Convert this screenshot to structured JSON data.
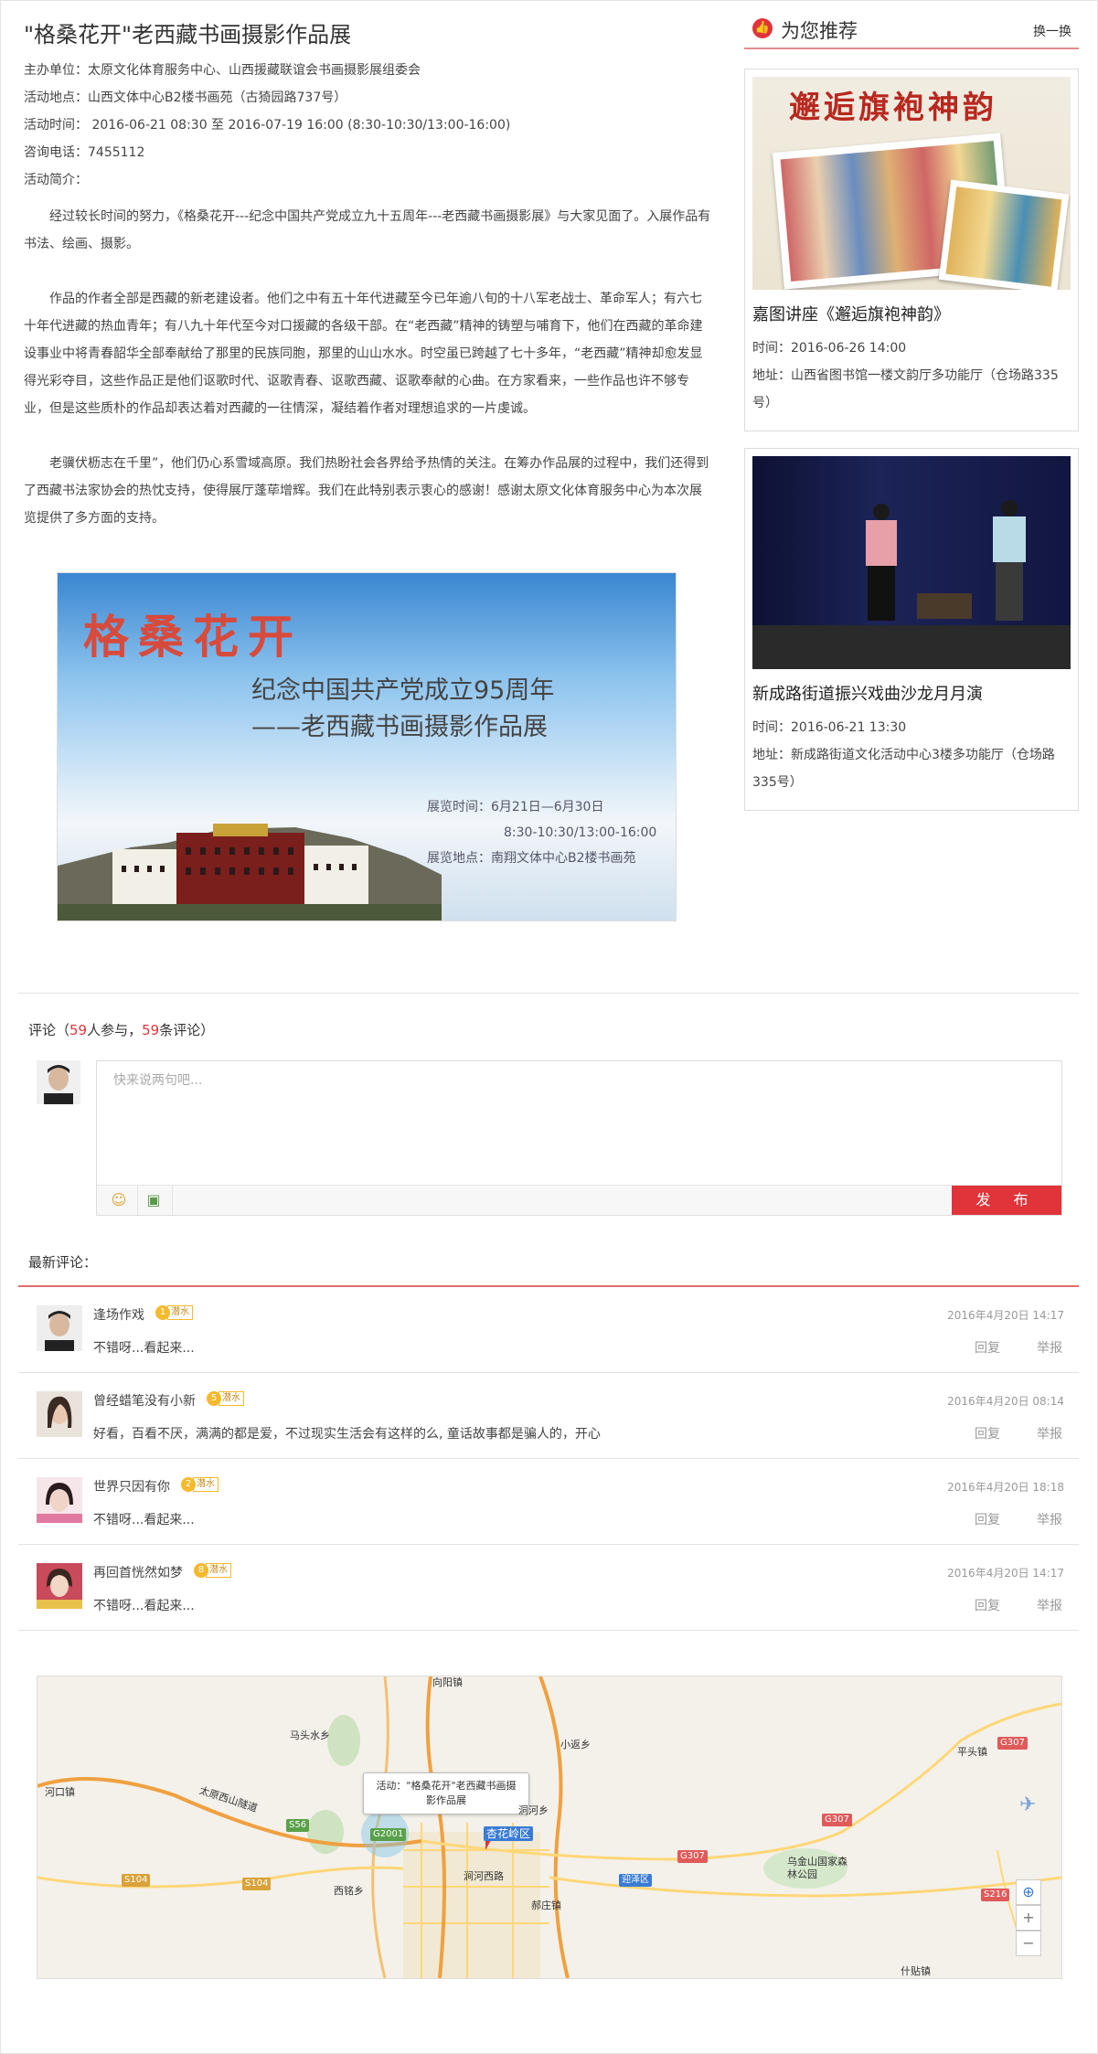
{
  "event": {
    "title": "\"格桑花开\"老西藏书画摄影作品展",
    "meta": [
      "主办单位：太原文化体育服务中心、山西援藏联谊会书画摄影展组委会",
      "活动地点：山西文体中心B2楼书画苑（古猗园路737号）",
      "活动时间： 2016-06-21 08:30 至 2016-07-19 16:00 (8:30-10:30/13:00-16:00)",
      "咨询电话：7455112",
      "活动简介："
    ],
    "intro": [
      "经过较长时间的努力，《格桑花开---纪念中国共产党成立九十五周年---老西藏书画摄影展》与大家见面了。入展作品有书法、绘画、摄影。",
      "作品的作者全部是西藏的新老建设者。他们之中有五十年代进藏至今已年逾八旬的十八军老战士、革命军人；有六七十年代进藏的热血青年；有八九十年代至今对口援藏的各级干部。在“老西藏”精神的铸塑与哺育下，他们在西藏的革命建设事业中将青春韶华全部奉献给了那里的民族同胞，那里的山山水水。时空虽已跨越了七十多年，“老西藏”精神却愈发显得光彩夺目，这些作品正是他们讴歌时代、讴歌青春、讴歌西藏、讴歌奉献的心曲。在方家看来，一些作品也许不够专业，但是这些质朴的作品却表达着对西藏的一往情深，凝结着作者对理想追求的一片虔诚。",
      "老骥伏枥志在千里”，他们仍心系雪域高原。我们热盼社会各界给予热情的关注。在筹办作品展的过程中，我们还得到了西藏书法家协会的热忱支持，使得展厅蓬荜增辉。我们在此特别表示衷心的感谢！感谢太原文化体育服务中心为本次展览提供了多方面的支持。"
    ],
    "poster": {
      "big": "格桑花开",
      "line1": "纪念中国共产党成立95周年",
      "line2": "——老西藏书画摄影作品展",
      "info1": "展览时间：6月21日—6月30日",
      "info2": "8:30-10:30/13:00-16:00",
      "info3": "展览地点：南翔文体中心B2楼书画苑"
    }
  },
  "recommend": {
    "title": "为您推荐",
    "swap": "换一换",
    "cards": [
      {
        "img_text": "邂逅旗袍神韵",
        "title": "嘉图讲座《邂逅旗袍神韵》",
        "time": "时间：2016-06-26 14:00",
        "addr": "地址：山西省图书馆一楼文韵厅多功能厅（仓场路335号）"
      },
      {
        "title": "新成路街道振兴戏曲沙龙月月演",
        "time": "时间：2016-06-21 13:30",
        "addr": "地址：新成路街道文化活动中心3楼多功能厅（仓场路335号）"
      }
    ]
  },
  "comments": {
    "head_prefix": "评论（",
    "participants": "59",
    "mid": "人参与，",
    "count": "59",
    "head_suffix": "条评论）",
    "placeholder": "快来说两句吧...",
    "publish": "发 布",
    "latest_label": "最新评论：",
    "list": [
      {
        "name": "逢场作戏",
        "level": "1",
        "tag": "潜水",
        "time": "2016年4月20日 14:17",
        "text": "不错呀...看起来...",
        "reply": "回复",
        "report": "举报"
      },
      {
        "name": "曾经蜡笔没有小新",
        "level": "5",
        "tag": "潜水",
        "time": "2016年4月20日 08:14",
        "text": "好看，百看不厌，满满的都是爱，不过现实生活会有这样的么, 童话故事都是骗人的，开心",
        "reply": "回复",
        "report": "举报"
      },
      {
        "name": "世界只因有你",
        "level": "2",
        "tag": "潜水",
        "time": "2016年4月20日 18:18",
        "text": "不错呀...看起来...",
        "reply": "回复",
        "report": "举报"
      },
      {
        "name": "再回首恍然如梦",
        "level": "8",
        "tag": "潜水",
        "time": "2016年4月20日 14:17",
        "text": "不错呀...看起来...",
        "reply": "回复",
        "report": "举报"
      }
    ]
  },
  "map": {
    "popup": "活动：\"格桑花开\"老西藏书画摄影作品展",
    "district": "杏花岭区",
    "places": [
      "马头水乡",
      "小返乡",
      "河口镇",
      "西铭乡",
      "平头镇",
      "迎泽区",
      "乌金山国家森林公园",
      "郝庄镇",
      "什贴镇",
      "洞河乡",
      "涧河西路",
      "向阳镇"
    ],
    "roads": [
      "S56",
      "G2001",
      "S104",
      "S104",
      "G307",
      "G307",
      "S216",
      "G307"
    ],
    "highway": "太原西山隧道"
  }
}
